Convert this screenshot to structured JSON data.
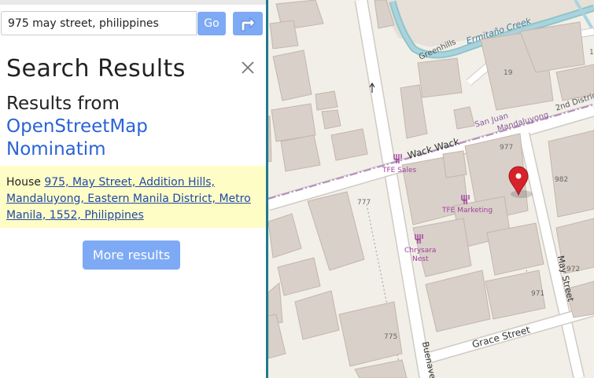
{
  "search": {
    "query": "975 may street, philippines",
    "go_label": "Go"
  },
  "results": {
    "title": "Search Results",
    "from_prefix": "Results from",
    "provider_line1": "OpenStreetMap",
    "provider_line2": "Nominatim",
    "items": [
      {
        "type_label": "House",
        "address": "975, May Street, Addition Hills, Mandaluyong, Eastern Manila District, Metro Manila, 1552, Philippines"
      }
    ],
    "more_label": "More results"
  },
  "map": {
    "labels": {
      "ermitano_creek": "Ermitaño Creek",
      "greenhills": "Greenhills",
      "wack_wack": "Wack Wack",
      "san_juan": "San Juan",
      "mandaluyong": "Mandaluyong",
      "second_district": "2nd District",
      "may_street": "May Street",
      "grace_street": "Grace Street",
      "buenaventura": "Buenave",
      "tfe_sales": "TFE Sales",
      "tfe_marketing": "TFE Marketing",
      "chrysara_line1": "Chrysara",
      "chrysara_line2": "Nest",
      "hn_19": "19",
      "hn_977": "977",
      "hn_982": "982",
      "hn_972": "972",
      "hn_971": "971",
      "hn_777": "777",
      "hn_775": "775",
      "hn_1": "1"
    },
    "colors": {
      "land": "#f2efe9",
      "building": "#d9d0c9",
      "building_stroke": "#c4b6ab",
      "road": "#ffffff",
      "road_casing": "#cfcac4",
      "water": "#aad3df",
      "creek_edge": "#7ec8a8",
      "boundary": "#b48cc0",
      "marker": "#d6232b",
      "poi": "#a0409c",
      "button": "#7eaaf5",
      "link": "#2a63d6",
      "result_bg": "#fffdc6",
      "divider": "#1f7a8c"
    }
  }
}
